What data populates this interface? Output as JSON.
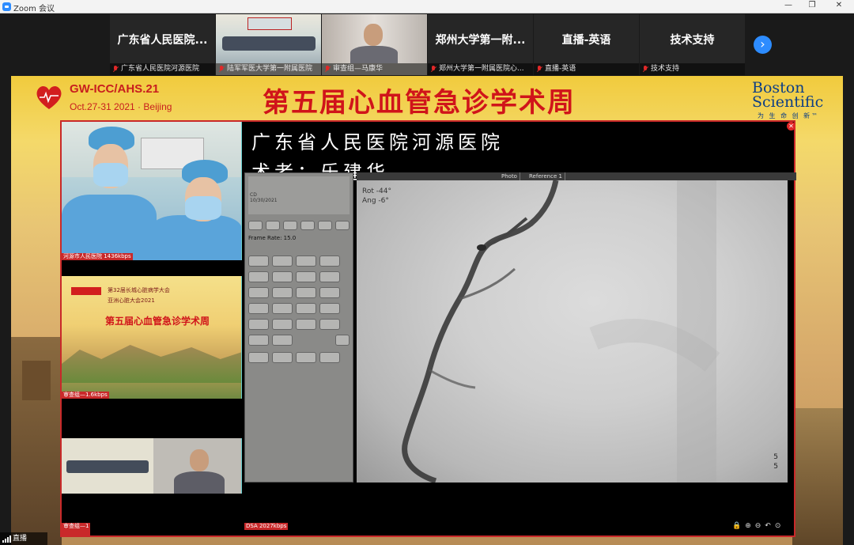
{
  "window": {
    "title": "Zoom 会议",
    "controls": [
      "—",
      "❐",
      "✕"
    ]
  },
  "thumbnails": [
    {
      "big": "广东省人民医院...",
      "name": "广东省人民医院河源医院"
    },
    {
      "big": "",
      "name": "陆军军医大学第一附属医院"
    },
    {
      "big": "",
      "name": "审查组—马康华"
    },
    {
      "big": "郑州大学第一附...",
      "name": "郑州大学第一附属医院心..."
    },
    {
      "big": "直播-英语",
      "name": "直播-英语"
    },
    {
      "big": "技术支持",
      "name": "技术支持"
    }
  ],
  "next_button": "›",
  "banner": {
    "logo": "GW-ICC/AHS.21",
    "date": "Oct.27-31 2021 · Beijing",
    "title": "第五届心血管急诊学术周",
    "sponsor_line1": "Boston",
    "sponsor_line2": "Scientific",
    "sponsor_sub": "为 生 命 创 新™"
  },
  "presentation": {
    "close": "✕",
    "slide_line1": "广东省人民医院河源医院",
    "slide_line2": "术者：乐建华",
    "tile1_label": "河源市人民医院 1436kbps",
    "tile2_title": "第五届心血管急诊学术周",
    "tile2_sub1": "第32届长城心脏病学大会",
    "tile2_sub2": "亚洲心脏大会2021",
    "tile2_label": "审查组—1.6kbps",
    "tile3_label": "审查组—1",
    "bottom_label": "DSA 2027kbps",
    "tabs": [
      "Photo",
      "Reference 1"
    ],
    "frame_rate": "Frame Rate: 15.0",
    "info_lines": [
      "CD",
      "10/30/2021"
    ],
    "angio_stats": [
      "Rot  -44°",
      "Ang   -6°"
    ],
    "angio_corner": [
      "5",
      "5"
    ],
    "zoom_tools": "🔒⊕⊖↶⊙"
  },
  "status": {
    "label": "直播"
  }
}
